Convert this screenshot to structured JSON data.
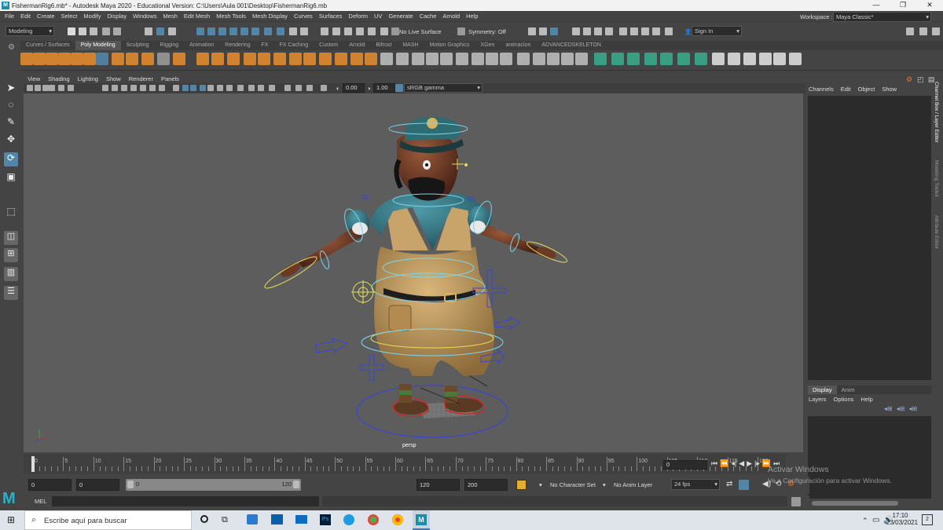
{
  "title_bar": {
    "text": "FishermanRig6.mb* - Autodesk Maya 2020 - Educational Version: C:\\Users\\Aula 001\\Desktop\\FishermanRig6.mb",
    "minimize": "—",
    "maximize": "❐",
    "close": "✕"
  },
  "menu": [
    "File",
    "Edit",
    "Create",
    "Select",
    "Modify",
    "Display",
    "Windows",
    "Mesh",
    "Edit Mesh",
    "Mesh Tools",
    "Mesh Display",
    "Curves",
    "Surfaces",
    "Deform",
    "UV",
    "Generate",
    "Cache",
    "Arnold",
    "Help"
  ],
  "workspace": {
    "label": "Workspace :",
    "value": "Maya Classic*"
  },
  "status_line": {
    "menu_set": "Modeling",
    "live_surface": "No Live Surface",
    "symmetry": "Symmetry: Off",
    "sign_in": "Sign In"
  },
  "shelf_tabs": [
    "Curves / Surfaces",
    "Poly Modeling",
    "Sculpting",
    "Rigging",
    "Animation",
    "Rendering",
    "FX",
    "FX Caching",
    "Custom",
    "Arnold",
    "Bifrost",
    "MASH",
    "Motion Graphics",
    "XGen",
    "animacion",
    "ADVANCEDSKELETON"
  ],
  "shelf_active": "Poly Modeling",
  "viewport_menu": [
    "View",
    "Shading",
    "Lighting",
    "Show",
    "Renderer",
    "Panels"
  ],
  "viewport_bar": {
    "exposure": "0.00",
    "gamma": "1.00",
    "colorspace": "sRGB gamma"
  },
  "camera_label": "persp",
  "channel_box": {
    "vertical_tabs": [
      "Channel Box / Layer Editor",
      "Modeling Toolkit",
      "Attribute Editor"
    ],
    "menu": [
      "Channels",
      "Edit",
      "Object",
      "Show"
    ]
  },
  "layer_editor": {
    "tabs": [
      "Display",
      "Anim"
    ],
    "menu": [
      "Layers",
      "Options",
      "Help"
    ]
  },
  "timeline": {
    "ticks": [
      0,
      5,
      10,
      15,
      20,
      25,
      30,
      35,
      40,
      45,
      50,
      55,
      60,
      65,
      70,
      75,
      80,
      85,
      90,
      95,
      100,
      105,
      110,
      115,
      120
    ],
    "current_frame": "0"
  },
  "range": {
    "start": "0",
    "anim_start": "0",
    "slider_min": "0",
    "slider_max": "120",
    "end": "120",
    "anim_end": "200",
    "character_set": "No Character Set",
    "anim_layer": "No Anim Layer",
    "fps": "24 fps"
  },
  "command_line": {
    "label": "MEL"
  },
  "watermark": {
    "line1": "Activar Windows",
    "line2": "Ve a Configuración para activar Windows."
  },
  "taskbar": {
    "search": "Escribe aquí para buscar",
    "time": "17:10",
    "date": "23/03/2021",
    "notifications": "2"
  },
  "colors": {
    "accent_blue": "#5285a6",
    "shelf_orange": "#e08a2c",
    "rig_yellow": "#e8e05a",
    "rig_cyan": "#7ad6f0",
    "rig_blue": "#3a46d6",
    "rig_red": "#e02020"
  }
}
